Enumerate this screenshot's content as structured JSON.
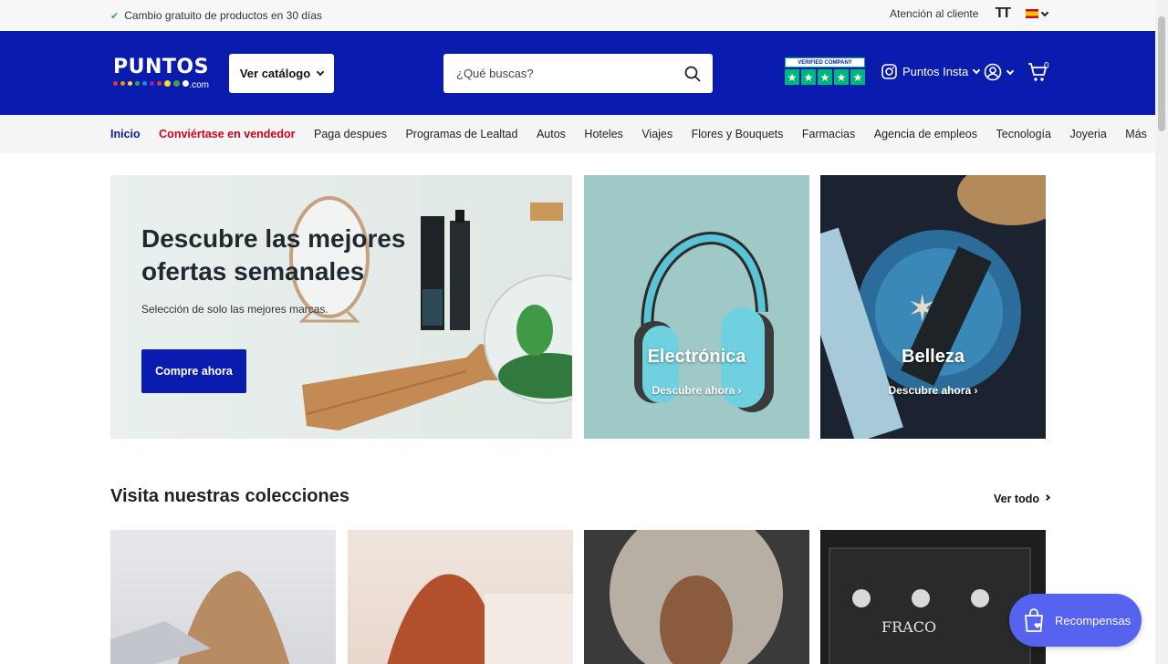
{
  "topbar": {
    "promo": "Cambio gratuito de productos en 30 días",
    "support": "Atención al cliente"
  },
  "header": {
    "logo_word": "PUNTOS",
    "logo_suffix": ".com",
    "catalog_label": "Ver catálogo",
    "search_placeholder": "¿Qué buscas?",
    "trust_badge": "VERIFIED COMPANY",
    "insta_label": "Puntos Insta",
    "cart_count": "0",
    "brand_color": "#0a1cad"
  },
  "nav": {
    "items": [
      "Inicio",
      "Conviértase en vendedor",
      "Paga despues",
      "Programas de Lealtad",
      "Autos",
      "Hoteles",
      "Viajes",
      "Flores y Bouquets",
      "Farmacias",
      "Agencia de empleos",
      "Tecnología",
      "Joyeria",
      "Más"
    ]
  },
  "hero": {
    "title": "Descubre las mejores ofertas semanales",
    "subtitle": "Selección de solo las mejores marcas.",
    "cta": "Compre ahora"
  },
  "cards": [
    {
      "title": "Electrónica",
      "link": "Descubre ahora"
    },
    {
      "title": "Belleza",
      "link": "Descubre ahora"
    }
  ],
  "collections": {
    "title": "Visita nuestras colecciones",
    "see_all": "Ver todo"
  },
  "rewards": {
    "label": "Recompensas"
  }
}
